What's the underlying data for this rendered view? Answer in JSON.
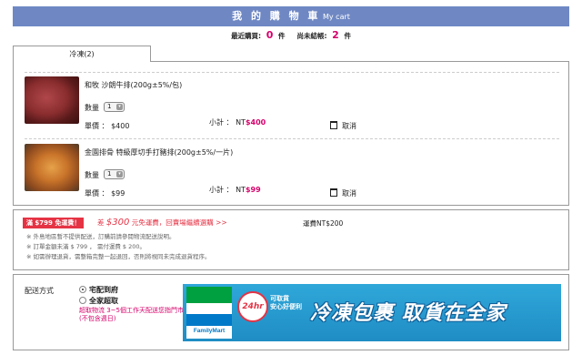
{
  "header": {
    "title": "我 的 購 物 車",
    "subtitle": "My cart"
  },
  "summary": {
    "recent_label": "最近購買:",
    "recent_count": "0",
    "recent_unit": "件",
    "pending_label": "尚未結帳:",
    "pending_count": "2",
    "pending_unit": "件"
  },
  "tabs": [
    {
      "label": "冷凍(2)"
    }
  ],
  "items": [
    {
      "name": "和牧 沙朗牛排(200g±5%/包)",
      "qty_label": "數量",
      "qty": "1",
      "price_label": "單價 ：",
      "price": "$400",
      "subtotal_label": "小計 ： NT",
      "subtotal": "$400",
      "cancel_label": "取消",
      "image": "steak-photo"
    },
    {
      "name": "金園排骨 特級厚切手打豬排(200g±5%/一片)",
      "qty_label": "數量",
      "qty": "1",
      "price_label": "單價 ：",
      "price": "$99",
      "subtotal_label": "小計 ： NT",
      "subtotal": "$99",
      "cancel_label": "取消",
      "image": "pork-cutlet-photo"
    }
  ],
  "promo": {
    "badge": "滿 $799 免運費！",
    "text_prefix": "差",
    "amount": "$300",
    "text_suffix": "元免運費，回賣場繼續選購 >>",
    "shipping_fee": "運費NT$200",
    "notes": [
      "※ 外島地區暫不提供配送，訂購前請參閱物流配送說明。",
      "※ 訂單金額未滿 $ 799 ， 需付運費 $ 200。",
      "※ 如需辦理退貨，需整箱完整一起退回，否則將視同未完成退貨程序。"
    ]
  },
  "delivery": {
    "label": "配送方式",
    "options": [
      {
        "label": "宅配到府",
        "selected": true
      },
      {
        "label": "全家超取",
        "selected": false
      }
    ],
    "pickup_note": "超取物流 3~5個工作天配送您指門市 (不包含週日)",
    "banner": {
      "logo_text": "FamilyMart",
      "hr_badge": "24hr",
      "tag_line1": "可取貨",
      "tag_line2": "安心好便利",
      "slogan": "冷凍包裹 取貨在全家"
    }
  },
  "colors": {
    "header_bg": "#6f88c4",
    "accent": "#d6006b",
    "promo_red": "#e53344",
    "banner_blue": "#2fa7d9"
  }
}
